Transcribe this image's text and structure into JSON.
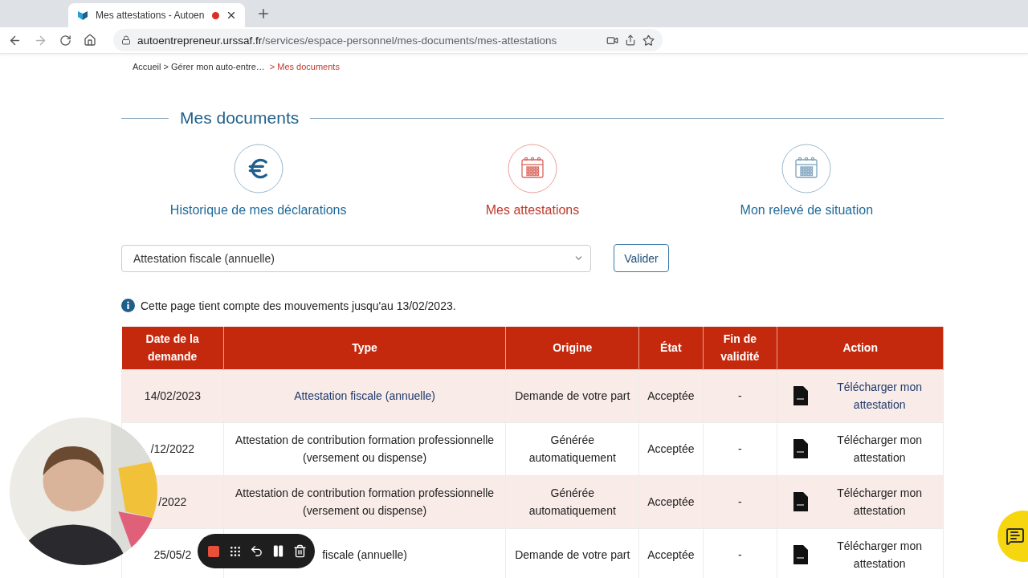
{
  "browser": {
    "tab": {
      "title": "Mes attestations - Autoen",
      "recording": true
    },
    "url": {
      "host": "autoentrepreneur.urssaf.fr",
      "path": "/services/espace-personnel/mes-documents/mes-attestations"
    }
  },
  "breadcrumb": [
    {
      "label": "Accueil > Gérer mon auto-entre…",
      "current": false
    },
    {
      "label": "> Mes documents",
      "current": true
    }
  ],
  "heading": "Mes documents",
  "nav": [
    {
      "label": "Historique de mes déclarations",
      "kind": "euro",
      "selected": false
    },
    {
      "label": "Mes attestations",
      "kind": "calendar",
      "selected": true
    },
    {
      "label": "Mon relevé de situation",
      "kind": "calendar",
      "selected": false
    }
  ],
  "filter": {
    "value": "Attestation fiscale (annuelle)",
    "button": "Valider"
  },
  "info": "Cette page tient compte des mouvements jusqu'au 13/02/2023.",
  "table": {
    "columns": [
      "Date de la demande",
      "Type",
      "Origine",
      "État",
      "Fin de validité",
      "Action"
    ],
    "rows": [
      {
        "hovered": true,
        "cells": [
          "14/02/2023",
          "Attestation fiscale (annuelle)",
          "Demande de votre part",
          "Acceptée",
          "-",
          "Télécharger mon attestation"
        ]
      },
      {
        "hovered": false,
        "cells": [
          "/12/2022",
          "Attestation de contribution formation professionnelle (versement ou dispense)",
          "Générée automatiquement",
          "Acceptée",
          "-",
          "Télécharger mon attestation"
        ]
      },
      {
        "hovered": false,
        "cells": [
          "/2022",
          "Attestation de contribution formation professionnelle (versement ou dispense)",
          "Générée automatiquement",
          "Acceptée",
          "-",
          "Télécharger mon attestation"
        ]
      },
      {
        "hovered": false,
        "cells": [
          "25/05/2",
          "fiscale (annuelle)",
          "Demande de votre part",
          "Acceptée",
          "-",
          "Télécharger mon attestation"
        ]
      }
    ]
  }
}
